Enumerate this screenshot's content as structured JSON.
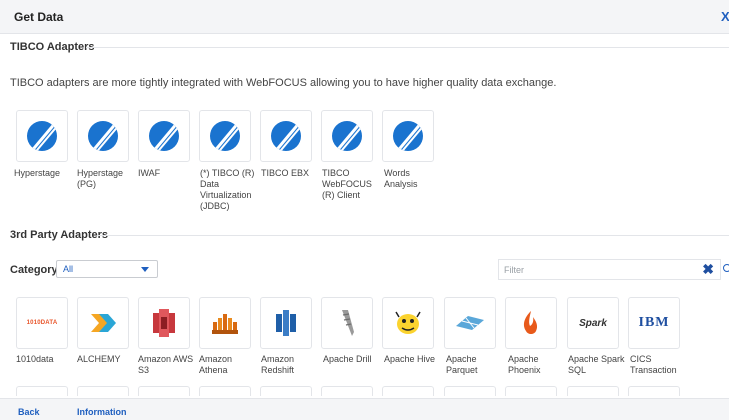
{
  "dialog": {
    "title": "Get Data",
    "close_glyph": "X"
  },
  "tibco": {
    "heading": "TIBCO Adapters",
    "description": "TIBCO adapters are more tightly integrated with WebFOCUS allowing you to have higher quality data exchange.",
    "adapters": [
      "Hyperstage",
      "Hyperstage (PG)",
      "IWAF",
      "(*) TIBCO (R) Data Virtualization (JDBC)",
      "TIBCO EBX",
      "TIBCO WebFOCUS (R) Client",
      "Words Analysis"
    ]
  },
  "third_party": {
    "heading": "3rd Party Adapters",
    "category_label": "Category",
    "category_value": "All",
    "filter_placeholder": "Filter",
    "clear_glyph": "✖",
    "adapters": [
      {
        "label": "1010data",
        "icon": "1010data-logo-icon",
        "logo_text": "1010DATA"
      },
      {
        "label": "ALCHEMY",
        "icon": "alchemy-logo-icon"
      },
      {
        "label": "Amazon AWS S3",
        "icon": "amazon-s3-logo-icon"
      },
      {
        "label": "Amazon Athena",
        "icon": "amazon-athena-logo-icon"
      },
      {
        "label": "Amazon Redshift",
        "icon": "amazon-redshift-logo-icon"
      },
      {
        "label": "Apache Drill",
        "icon": "apache-drill-logo-icon"
      },
      {
        "label": "Apache Hive",
        "icon": "apache-hive-logo-icon"
      },
      {
        "label": "Apache Parquet",
        "icon": "apache-parquet-logo-icon"
      },
      {
        "label": "Apache Phoenix",
        "icon": "apache-phoenix-logo-icon"
      },
      {
        "label": "Apache Spark SQL",
        "icon": "apache-spark-logo-icon",
        "logo_text": "Spark"
      },
      {
        "label": "CICS Transaction",
        "icon": "ibm-logo-icon",
        "logo_text": "IBM"
      }
    ]
  },
  "footer": {
    "back_label": "Back",
    "info_label": "Information"
  },
  "colors": {
    "accent": "#1f5fbf",
    "tibco_blue": "#1a73cf",
    "chrome": "#f4f5f7",
    "border": "#e3e5e9"
  }
}
